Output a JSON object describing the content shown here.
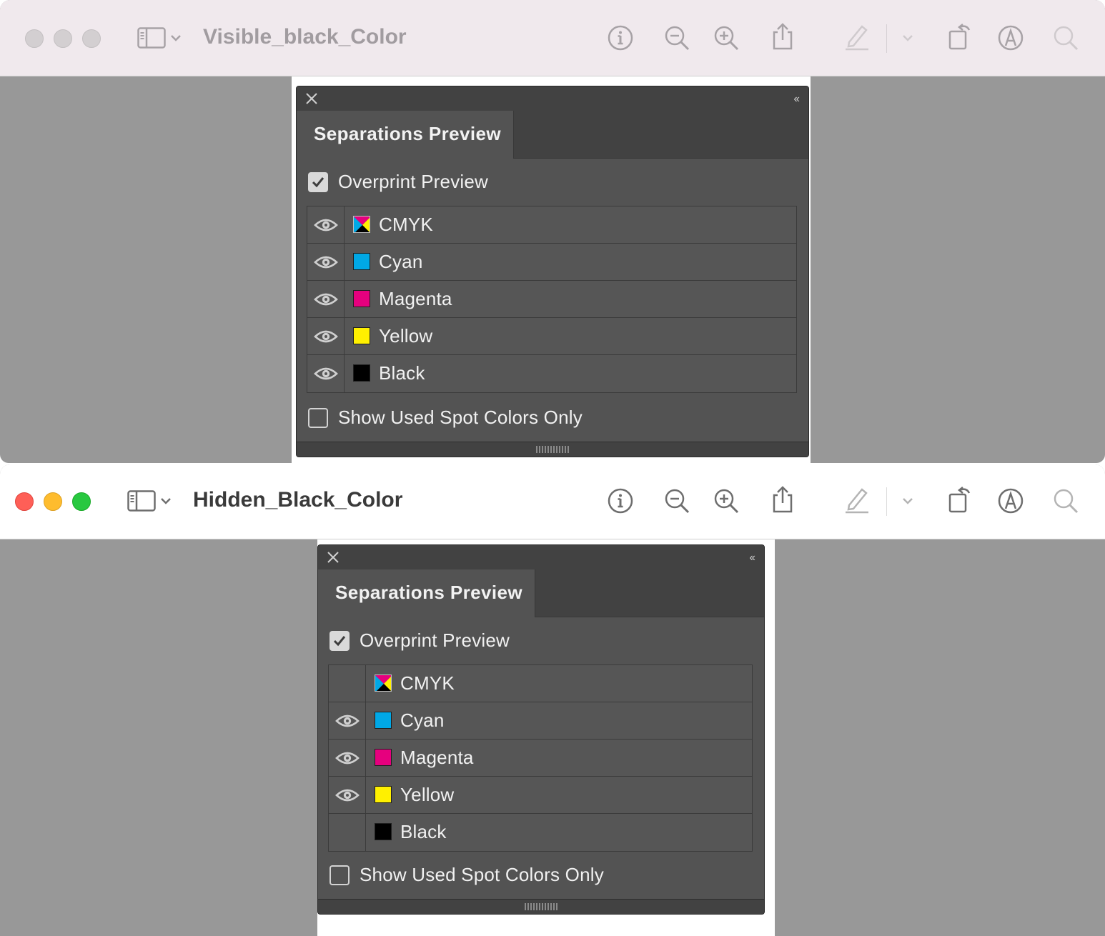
{
  "windows": [
    {
      "title": "Visible_black_Color",
      "active": false,
      "panel": {
        "tab_label": "Separations Preview",
        "overprint_label": "Overprint Preview",
        "overprint_checked": true,
        "spot_label": "Show Used Spot Colors Only",
        "spot_checked": false,
        "separations": [
          {
            "name": "CMYK",
            "visible": true,
            "swatch": "cmyk"
          },
          {
            "name": "Cyan",
            "visible": true,
            "swatch": "#00a8e6"
          },
          {
            "name": "Magenta",
            "visible": true,
            "swatch": "#e6007e"
          },
          {
            "name": "Yellow",
            "visible": true,
            "swatch": "#fff000"
          },
          {
            "name": "Black",
            "visible": true,
            "swatch": "#000000"
          }
        ]
      }
    },
    {
      "title": "Hidden_Black_Color",
      "active": true,
      "panel": {
        "tab_label": "Separations Preview",
        "overprint_label": "Overprint Preview",
        "overprint_checked": true,
        "spot_label": "Show Used Spot Colors Only",
        "spot_checked": false,
        "separations": [
          {
            "name": "CMYK",
            "visible": false,
            "swatch": "cmyk"
          },
          {
            "name": "Cyan",
            "visible": true,
            "swatch": "#00a8e6"
          },
          {
            "name": "Magenta",
            "visible": true,
            "swatch": "#e6007e"
          },
          {
            "name": "Yellow",
            "visible": true,
            "swatch": "#fff000"
          },
          {
            "name": "Black",
            "visible": false,
            "swatch": "#000000"
          }
        ]
      }
    }
  ],
  "toolbar_icons": [
    "info-icon",
    "zoom-out-icon",
    "zoom-in-icon",
    "share-icon",
    "highlight-pen-icon",
    "chevron-down-icon",
    "rotate-icon",
    "markup-icon",
    "search-icon"
  ],
  "colors": {
    "panel_bg": "#535353",
    "panel_dark": "#424242",
    "canvas_gray": "#989898",
    "cyan": "#00a8e6",
    "magenta": "#e6007e",
    "yellow": "#fff000",
    "black": "#000000"
  }
}
